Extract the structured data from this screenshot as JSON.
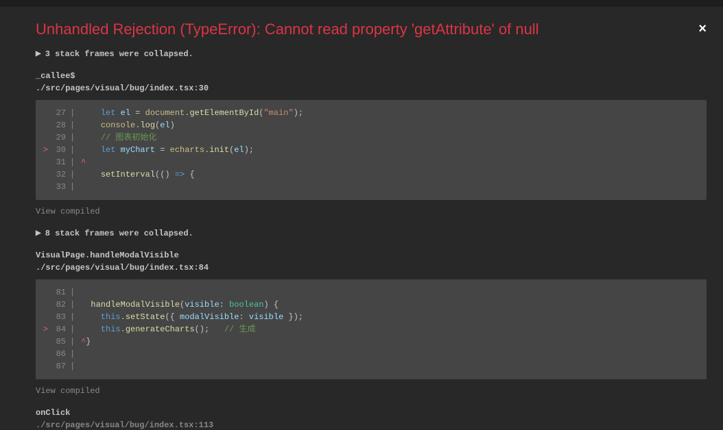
{
  "error": {
    "title": "Unhandled Rejection (TypeError): Cannot read property 'getAttribute' of null"
  },
  "close_label": "×",
  "frames": [
    {
      "collapse_text": "3 stack frames were collapsed.",
      "name": "_callee$",
      "location": "./src/pages/visual/bug/index.tsx:30",
      "view_compiled": "View compiled",
      "code": [
        {
          "n": "27",
          "content": "    let el = document.getElementById(\"main\");",
          "hl": false
        },
        {
          "n": "28",
          "content": "    console.log(el)",
          "hl": false
        },
        {
          "n": "29",
          "content": "    // 图表初始化",
          "hl": false
        },
        {
          "n": "30",
          "content": "    let myChart = echarts.init(el);",
          "hl": true
        },
        {
          "n": "31",
          "content": "^",
          "hl": false,
          "caret": true
        },
        {
          "n": "32",
          "content": "    setInterval(() => {",
          "hl": false
        },
        {
          "n": "33",
          "content": "",
          "hl": false
        }
      ]
    },
    {
      "collapse_text": "8 stack frames were collapsed.",
      "name": "VisualPage.handleModalVisible",
      "location": "./src/pages/visual/bug/index.tsx:84",
      "view_compiled": "View compiled",
      "code": [
        {
          "n": "81",
          "content": "",
          "hl": false
        },
        {
          "n": "82",
          "content": "  handleModalVisible(visible: boolean) {",
          "hl": false
        },
        {
          "n": "83",
          "content": "    this.setState({ modalVisible: visible });",
          "hl": false
        },
        {
          "n": "84",
          "content": "    this.generateCharts();   // 生成",
          "hl": true
        },
        {
          "n": "85",
          "content": "^}",
          "hl": false,
          "caret": true
        },
        {
          "n": "86",
          "content": "",
          "hl": false
        },
        {
          "n": "87",
          "content": "",
          "hl": false
        }
      ]
    },
    {
      "collapse_text": "",
      "name": "onClick",
      "location": "./src/pages/visual/bug/index.tsx:113",
      "view_compiled": "",
      "code": []
    }
  ]
}
